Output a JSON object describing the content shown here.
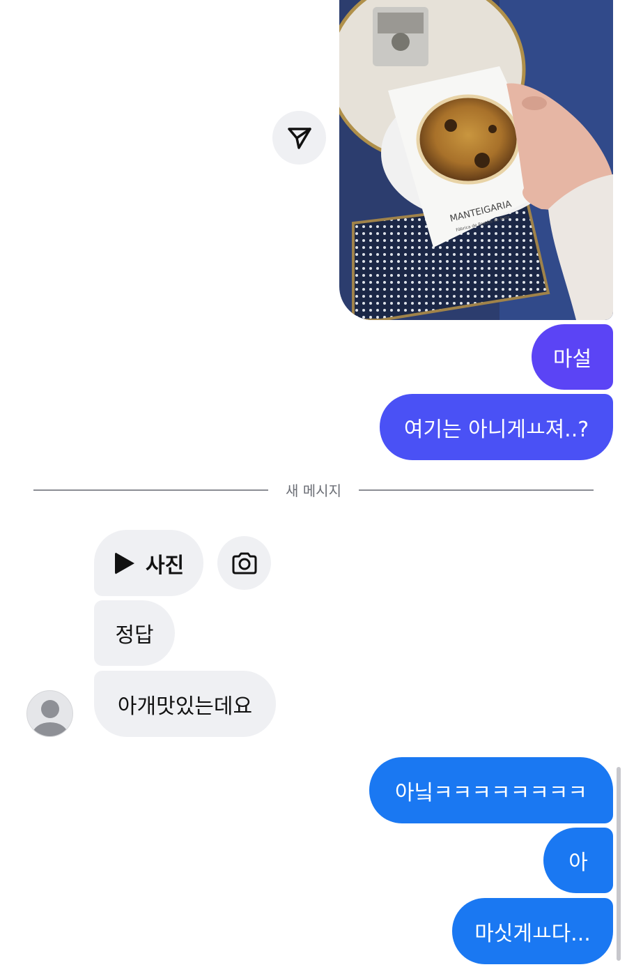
{
  "shared_photo": {
    "napkin_brand": "MANTEIGARIA",
    "napkin_subtitle": "Fábrica de Pastéis de Nata",
    "share_icon": "send-icon"
  },
  "messages_before": [
    {
      "text": "마설"
    },
    {
      "text": "여기는 아니게ㅛ져..?"
    }
  ],
  "divider": {
    "label": "새 메시지"
  },
  "incoming": {
    "photo_label": "사진",
    "photo_icon": "play-icon",
    "camera_icon": "camera-icon",
    "messages": [
      {
        "text": "정답"
      },
      {
        "text": "아개맛있는데요"
      }
    ],
    "avatar_icon": "user-avatar-icon"
  },
  "messages_after": [
    {
      "text": "아닠ㅋㅋㅋㅋㅋㅋㅋㅋ"
    },
    {
      "text": "아"
    },
    {
      "text": "마싯게ㅛ다..."
    }
  ],
  "colors": {
    "outgoing_purple": "#5b44f5",
    "outgoing_indigo": "#4a51f5",
    "outgoing_blue": "#1a78f2",
    "incoming_bg": "#eff0f3"
  }
}
